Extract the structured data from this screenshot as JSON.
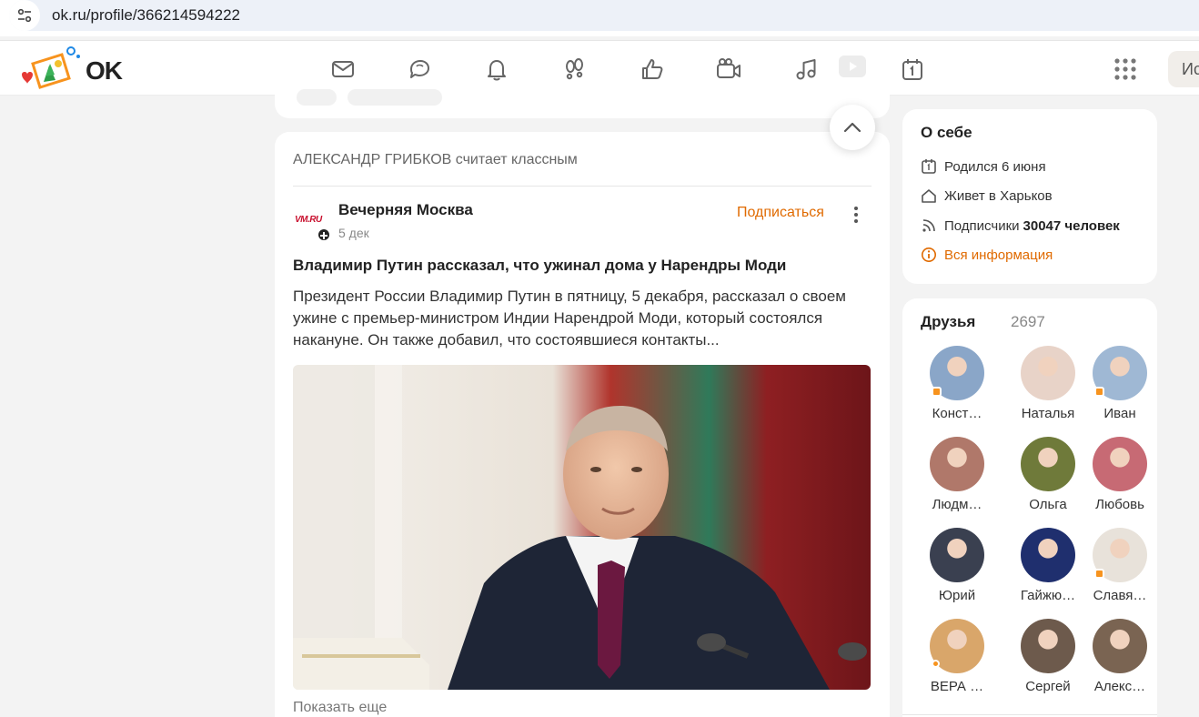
{
  "browser": {
    "url": "ok.ru/profile/366214594222"
  },
  "header": {
    "logo_text": "OK",
    "nav": [
      {
        "name": "messages-icon"
      },
      {
        "name": "discussions-icon"
      },
      {
        "name": "notifications-icon"
      },
      {
        "name": "guests-icon"
      },
      {
        "name": "reactions-icon"
      },
      {
        "name": "video-call-icon"
      },
      {
        "name": "music-icon"
      },
      {
        "name": "video-icon"
      },
      {
        "name": "events-icon"
      }
    ],
    "search_stub": "Ис"
  },
  "feed": {
    "liked_by": "АЛЕКСАНДР ГРИБКОВ",
    "liked_suffix": "считает классным",
    "source_logo": "VM.RU",
    "source_name": "Вечерняя Москва",
    "date": "5 дек",
    "subscribe_label": "Подписаться",
    "post_title": "Владимир Путин рассказал, что ужинал дома у Нарендры Моди",
    "post_body": "Президент России Владимир Путин в пятницу, 5 декабря, рассказал о своем ужине с премьер-министром Индии Нарендрой Моди, который состоялся накануне. Он также добавил, что состоявшиеся контакты...",
    "show_more": "Показать еще"
  },
  "about": {
    "title": "О себе",
    "born_label": "Родился",
    "born_value": "6 июня",
    "lives_label": "Живет в",
    "lives_value": "Харьков",
    "subs_label": "Подписчики",
    "subs_value": "30047 человек",
    "all_info": "Вся информация"
  },
  "friends": {
    "title": "Друзья",
    "count": "2697",
    "list": [
      {
        "name": "Конст…",
        "color": "#8aa6c8",
        "mark": "ok"
      },
      {
        "name": "Наталья",
        "color": "#e8d3c8",
        "mark": ""
      },
      {
        "name": "Иван",
        "color": "#9fb8d4",
        "mark": "ok"
      },
      {
        "name": "Людм…",
        "color": "#b0786a",
        "mark": ""
      },
      {
        "name": "Ольга",
        "color": "#6f7a3a",
        "mark": ""
      },
      {
        "name": "Любовь",
        "color": "#c76a74",
        "mark": ""
      },
      {
        "name": "Юрий",
        "color": "#3a4050",
        "mark": ""
      },
      {
        "name": "Гайжю…",
        "color": "#1f2f6e",
        "mark": ""
      },
      {
        "name": "Славя…",
        "color": "#e8e2da",
        "mark": "ok"
      },
      {
        "name": "ВЕРА …",
        "color": "#d9a66a",
        "mark": "online"
      },
      {
        "name": "Сергей",
        "color": "#6d5a4c",
        "mark": ""
      },
      {
        "name": "Алекс…",
        "color": "#7a6452",
        "mark": ""
      }
    ]
  },
  "colors": {
    "accent": "#e06a00",
    "ok_orange": "#f7931e"
  }
}
